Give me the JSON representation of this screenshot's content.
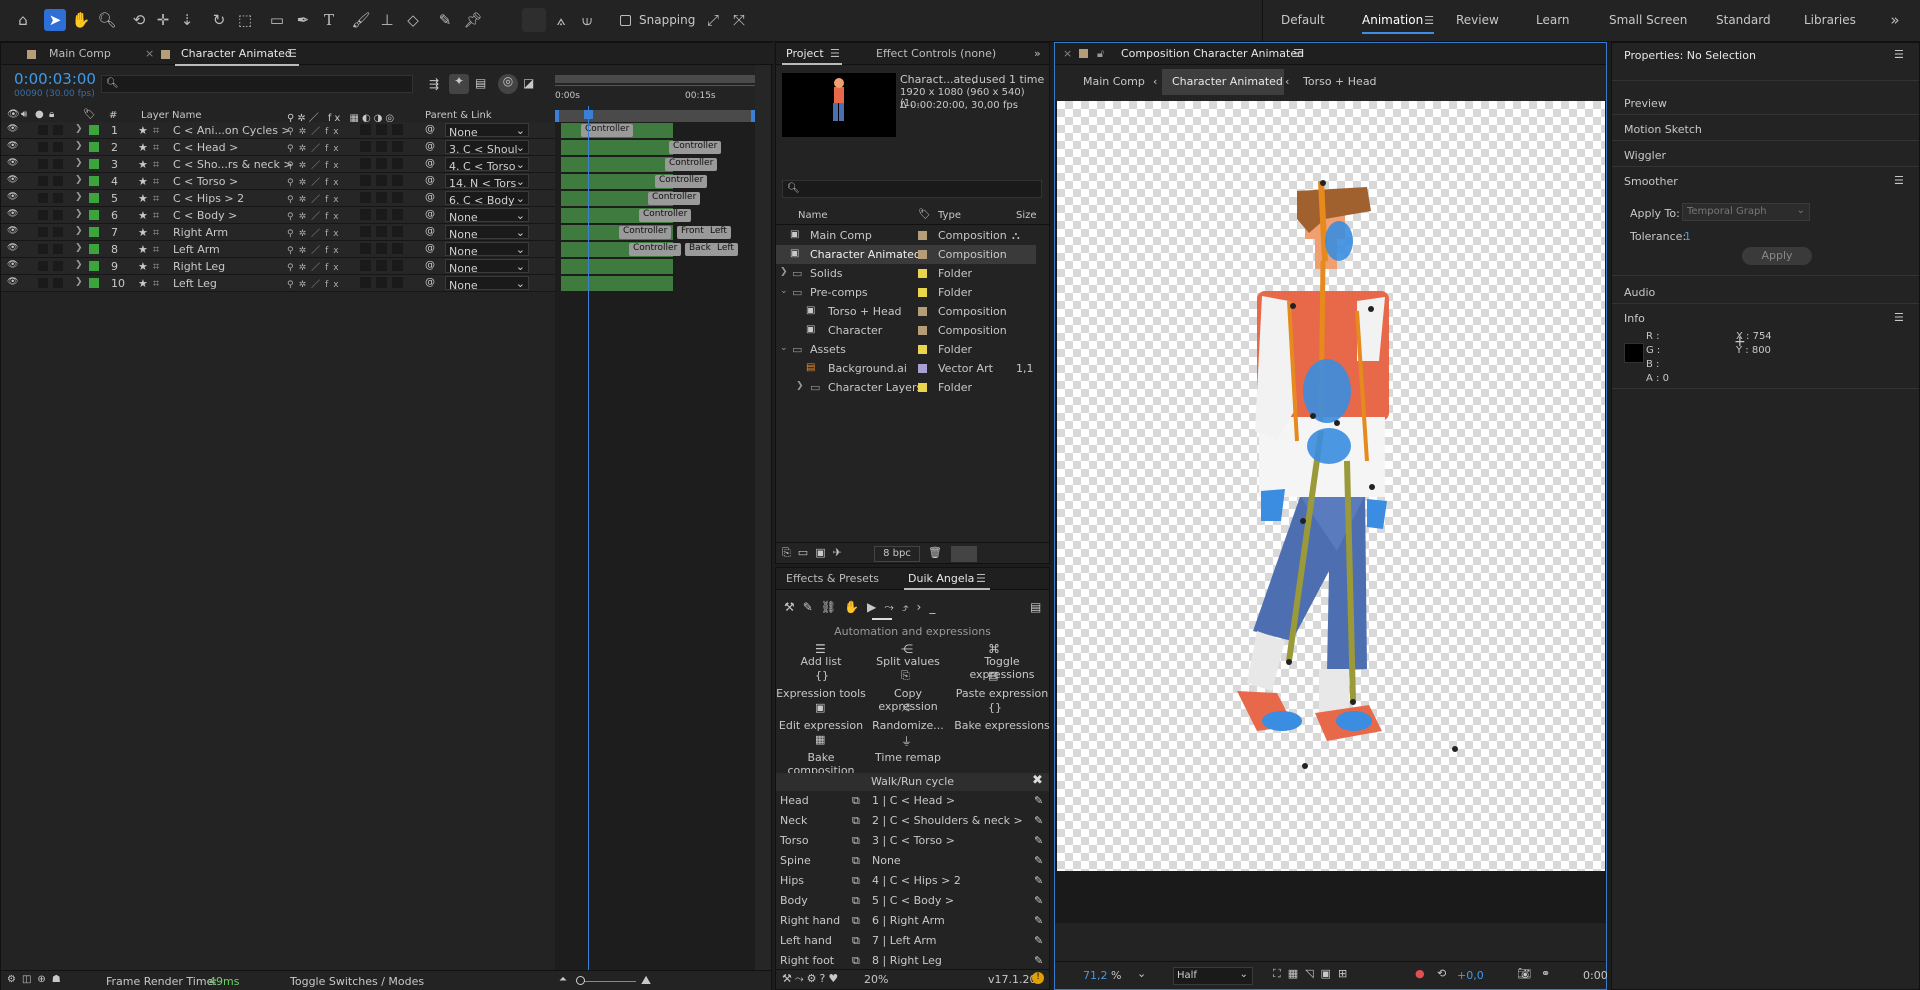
{
  "workspaces": [
    "Default",
    "Animation",
    "Review",
    "Learn",
    "Small Screen",
    "Standard",
    "Libraries"
  ],
  "workspace_active": "Animation",
  "toolbar": {
    "snapping_label": "Snapping",
    "snapping_checked": false
  },
  "timeline": {
    "tabs": [
      "Main Comp",
      "Character Animated"
    ],
    "timecode": "0:00:03:00",
    "frames": "00090 (30.00 fps)",
    "search_placeholder": "",
    "col_num": "#",
    "col_layer_name": "Layer Name",
    "col_parent": "Parent & Link",
    "ruler_start": "0:00s",
    "ruler_mid": "00:15s",
    "layers": [
      {
        "num": "1",
        "name": "C < Ani...on Cycles >",
        "parent": "None",
        "ctrl": [
          "Controller"
        ]
      },
      {
        "num": "2",
        "name": "C < Head >",
        "parent": "3. C < Shoul",
        "ctrl": [
          "Controller"
        ]
      },
      {
        "num": "3",
        "name": "C < Sho...rs & neck >",
        "parent": "4. C < Torso",
        "ctrl": [
          "Controller"
        ]
      },
      {
        "num": "4",
        "name": "C < Torso >",
        "parent": "14. N < Tors",
        "ctrl": [
          "Controller"
        ]
      },
      {
        "num": "5",
        "name": "C < Hips > 2",
        "parent": "6. C < Body",
        "ctrl": [
          "Controller"
        ]
      },
      {
        "num": "6",
        "name": "C < Body >",
        "parent": "None",
        "ctrl": [
          "Controller"
        ]
      },
      {
        "num": "7",
        "name": "Right Arm",
        "parent": "None",
        "ctrl": [
          "Controller",
          "Front",
          "Left"
        ]
      },
      {
        "num": "8",
        "name": "Left Arm",
        "parent": "None",
        "ctrl": [
          "Controller",
          "Back",
          "Left"
        ]
      },
      {
        "num": "9",
        "name": "Right Leg",
        "parent": "None",
        "ctrl": []
      },
      {
        "num": "10",
        "name": "Left Leg",
        "parent": "None",
        "ctrl": []
      }
    ],
    "footer_render": "Frame Render Time:",
    "footer_render_value": "49ms",
    "footer_toggle": "Toggle Switches / Modes"
  },
  "project": {
    "tab_project": "Project",
    "tab_effect_controls": "Effect Controls (none)",
    "preview_name": "Charact...ated",
    "preview_used": ", used 1 time",
    "preview_dims": "1920 x 1080  (960 x 540) (1,...",
    "preview_dur": "Δ 0:00:20:00, 30,00 fps",
    "col_name": "Name",
    "col_type": "Type",
    "col_size": "Size",
    "items": [
      {
        "name": "Main Comp",
        "type": "Composition",
        "color": "#b59d7a",
        "indent": 0,
        "kind": "comp",
        "size": ""
      },
      {
        "name": "Character Animated",
        "type": "Composition",
        "color": "#b59d7a",
        "indent": 0,
        "kind": "comp",
        "size": ""
      },
      {
        "name": "Solids",
        "type": "Folder",
        "color": "#e8d44d",
        "indent": 0,
        "kind": "folder",
        "size": ""
      },
      {
        "name": "Pre-comps",
        "type": "Folder",
        "color": "#e8d44d",
        "indent": 0,
        "kind": "folder",
        "size": ""
      },
      {
        "name": "Torso + Head",
        "type": "Composition",
        "color": "#b59d7a",
        "indent": 1,
        "kind": "comp",
        "size": ""
      },
      {
        "name": "Character",
        "type": "Composition",
        "color": "#b59d7a",
        "indent": 1,
        "kind": "comp",
        "size": ""
      },
      {
        "name": "Assets",
        "type": "Folder",
        "color": "#e8d44d",
        "indent": 0,
        "kind": "folder",
        "size": ""
      },
      {
        "name": "Background.ai",
        "type": "Vector Art",
        "color": "#a8a0d0",
        "indent": 1,
        "kind": "ai",
        "size": "1,1"
      },
      {
        "name": "Character Layers",
        "type": "Folder",
        "color": "#e8d44d",
        "indent": 1,
        "kind": "folder",
        "size": ""
      }
    ],
    "bpc": "8 bpc"
  },
  "duik": {
    "tab_effects": "Effects & Presets",
    "tab_duik": "Duik Angela",
    "section_title": "Automation and expressions",
    "buttons": [
      "Add list",
      "Split values",
      "Toggle expressions",
      "Expression tools",
      "Copy expression",
      "Paste expression",
      "Edit expression",
      "Randomize...",
      "Bake expressions",
      "Bake composition",
      "Time remap"
    ],
    "walk_title": "Walk/Run cycle",
    "walk_rows": [
      {
        "label": "Head",
        "value": "1 | C < Head >"
      },
      {
        "label": "Neck",
        "value": "2 | C < Shoulders & neck >"
      },
      {
        "label": "Torso",
        "value": "3 | C < Torso >"
      },
      {
        "label": "Spine",
        "value": "None"
      },
      {
        "label": "Hips",
        "value": "4 | C < Hips > 2"
      },
      {
        "label": "Body",
        "value": "5 | C < Body >"
      },
      {
        "label": "Right hand",
        "value": "6 | Right Arm"
      },
      {
        "label": "Left hand",
        "value": "7 | Left Arm"
      },
      {
        "label": "Right foot",
        "value": "8 | Right Leg"
      }
    ],
    "footer_pct": "20%",
    "footer_version": "v17.1.20"
  },
  "composition": {
    "title": "Composition Character Animated",
    "breadcrumbs": [
      "Main Comp",
      "Character Animated",
      "Torso + Head"
    ],
    "zoom": "71,2",
    "zoom_unit": "%",
    "resolution": "Half",
    "exposure": "+0,0",
    "time": "0:00"
  },
  "properties": {
    "title": "Properties: No Selection",
    "sections": [
      "Preview",
      "Motion Sketch",
      "Wiggler",
      "Smoother"
    ],
    "apply_to_label": "Apply To:",
    "apply_to_value": "Temporal Graph",
    "tolerance_label": "Tolerance:",
    "tolerance_value": "1",
    "apply_button": "Apply",
    "audio": "Audio",
    "info": "Info",
    "r": "R :",
    "g": "G :",
    "b": "B :",
    "a": "A :  0",
    "x": "X : 754",
    "y": "Y : 800"
  },
  "colors": {
    "accent": "#2d8ceb",
    "label_green": "#3da43d",
    "timeline_bar": "#3f7a3f"
  }
}
